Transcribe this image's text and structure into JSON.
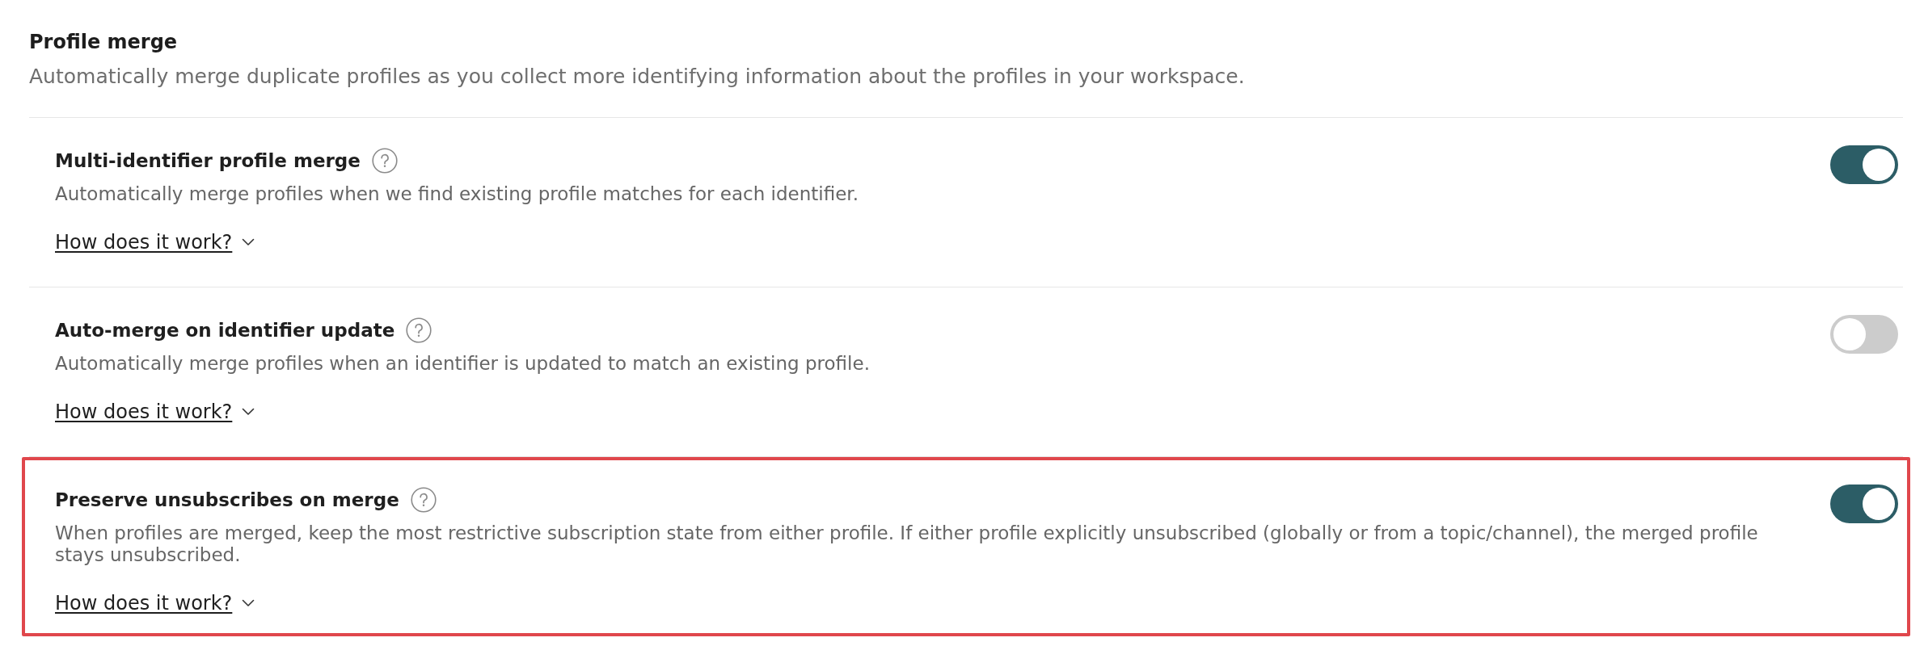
{
  "section": {
    "title": "Profile merge",
    "description": "Automatically merge duplicate profiles as you collect more identifying information about the profiles in your workspace."
  },
  "settings": [
    {
      "title": "Multi-identifier profile merge",
      "description": "Automatically merge profiles when we find existing profile matches for each identifier.",
      "link": "How does it work?",
      "expanded": false,
      "on": true,
      "highlighted": false
    },
    {
      "title": "Auto-merge on identifier update",
      "description": "Automatically merge profiles when an identifier is updated to match an existing profile.",
      "link": "How does it work?",
      "expanded": false,
      "on": false,
      "highlighted": false
    },
    {
      "title": "Preserve unsubscribes on merge",
      "description": "When profiles are merged, keep the most restrictive subscription state from either profile. If either profile explicitly unsubscribed (globally or from a topic/channel), the merged profile stays unsubscribed.",
      "link": "How does it work?",
      "expanded": false,
      "on": true,
      "highlighted": true
    }
  ]
}
